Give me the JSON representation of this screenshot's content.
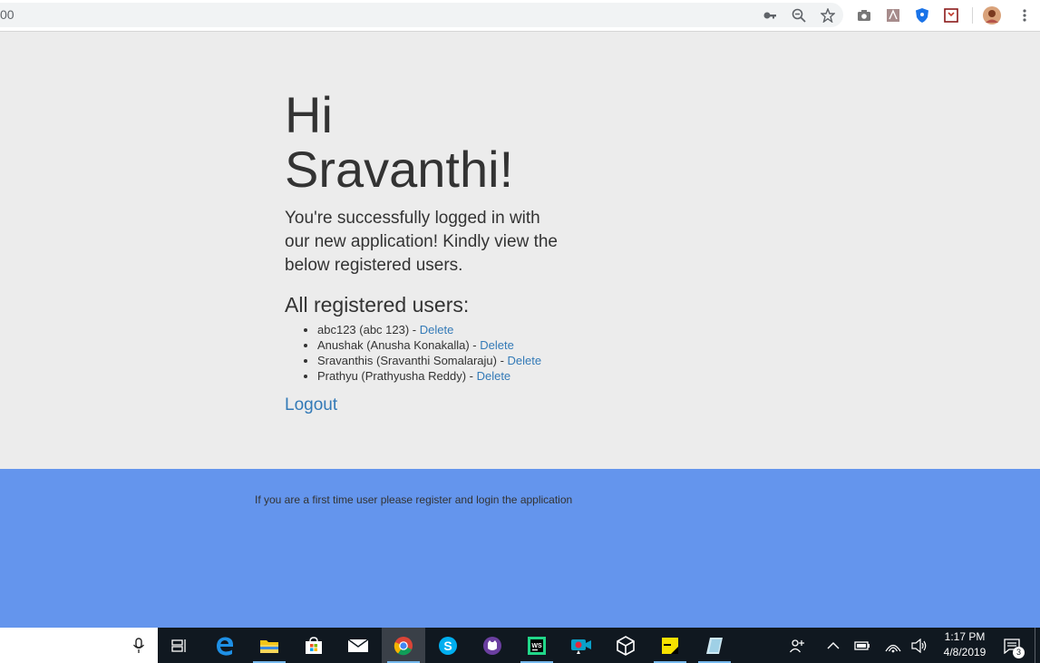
{
  "browser": {
    "address_text": "00",
    "toolbar_icons": [
      "key-icon",
      "zoom-icon",
      "star-icon",
      "camera-icon",
      "pdf-icon",
      "shield-icon",
      "extension-icon",
      "profile-avatar"
    ]
  },
  "page": {
    "greeting": "Hi Sravanthi!",
    "intro": "You're successfully logged in with our new application! Kindly view the below registered users.",
    "users_heading": "All registered users:",
    "users": [
      {
        "text": "abc123 (abc 123) - ",
        "action": "Delete"
      },
      {
        "text": "Anushak (Anusha Konakalla) - ",
        "action": "Delete"
      },
      {
        "text": "Sravanthis (Sravanthi Somalaraju) - ",
        "action": "Delete"
      },
      {
        "text": "Prathyu (Prathyusha Reddy) - ",
        "action": "Delete"
      }
    ],
    "logout_label": "Logout",
    "link_color": "#337ab7"
  },
  "footer": {
    "text": "If you are a first time user please register and login the application",
    "background": "#6495ed"
  },
  "taskbar": {
    "apps": [
      "microphone-icon",
      "task-view-icon",
      "edge-icon",
      "file-explorer-icon",
      "store-icon",
      "mail-icon",
      "chrome-icon",
      "skype-icon",
      "app-icon",
      "webstorm-icon",
      "camera-app-icon",
      "virtualbox-icon",
      "sticky-notes-icon",
      "notes-icon"
    ],
    "time": "1:17 PM",
    "date": "4/8/2019",
    "notification_count": "3"
  }
}
